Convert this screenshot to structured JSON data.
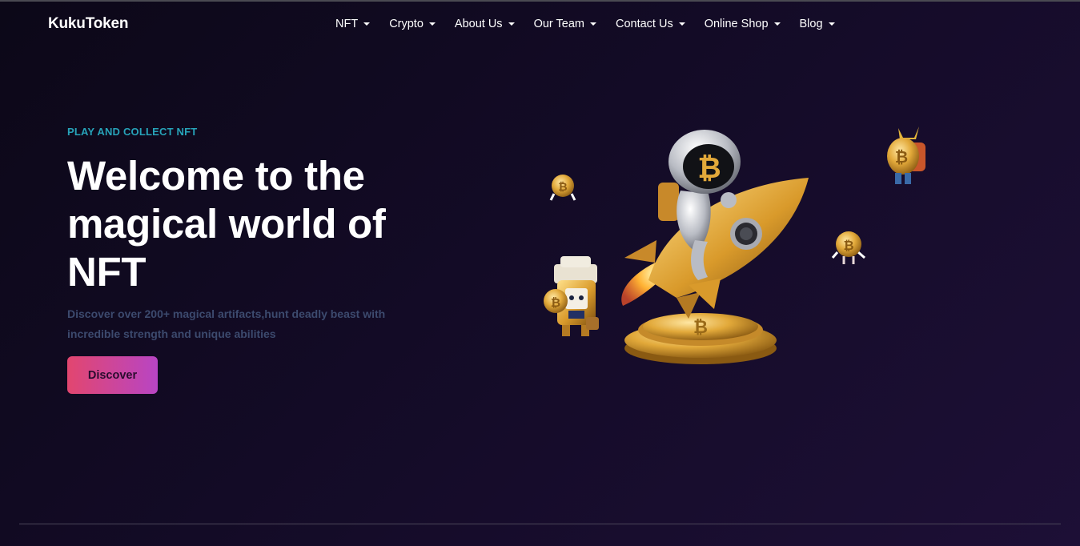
{
  "brand": "KukuToken",
  "nav": [
    {
      "label": "NFT",
      "name": "nav-nft"
    },
    {
      "label": "Crypto",
      "name": "nav-crypto"
    },
    {
      "label": "About Us",
      "name": "nav-about-us"
    },
    {
      "label": "Our Team",
      "name": "nav-our-team"
    },
    {
      "label": "Contact Us",
      "name": "nav-contact-us"
    },
    {
      "label": "Online Shop",
      "name": "nav-online-shop"
    },
    {
      "label": "Blog",
      "name": "nav-blog"
    }
  ],
  "hero": {
    "kicker": "PLAY AND COLLECT NFT",
    "title_lines": [
      "Welcome to the",
      "magical world of",
      "NFT"
    ],
    "description": "Discover over 200+ magical artifacts,hunt deadly beast with incredible strength and unique abilities",
    "button": "Discover",
    "coin_symbol": "₿"
  },
  "colors": {
    "accent_cyan": "#27a3b9",
    "button_gradient_start": "#e2466f",
    "button_gradient_end": "#b845c4",
    "gold": "#e2a93a"
  }
}
